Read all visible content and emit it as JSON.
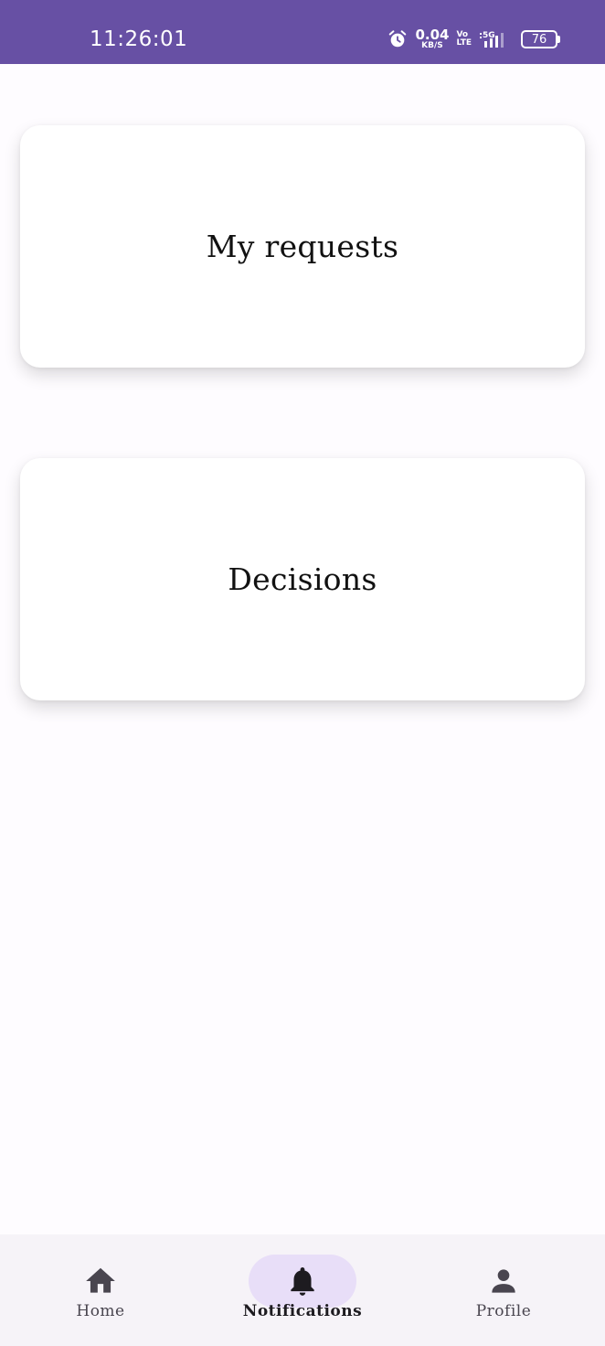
{
  "status_bar": {
    "time": "11:26:01",
    "net_speed_value": "0.04",
    "net_speed_unit": "KB/S",
    "volte_top": "Vo",
    "volte_bottom": "LTE",
    "network": "5G",
    "battery": "76",
    "icons": [
      "alarm-icon",
      "signal-icon",
      "battery-icon"
    ],
    "background_color": "#6750a4"
  },
  "cards": {
    "requests_label": "My requests",
    "decisions_label": "Decisions"
  },
  "bottom_nav": {
    "active": "notifications",
    "active_indicator_color": "#e8def8",
    "items": [
      {
        "id": "home",
        "label": "Home",
        "icon": "home-icon"
      },
      {
        "id": "notifications",
        "label": "Notifications",
        "icon": "bell-icon"
      },
      {
        "id": "profile",
        "label": "Profile",
        "icon": "person-icon"
      }
    ]
  }
}
